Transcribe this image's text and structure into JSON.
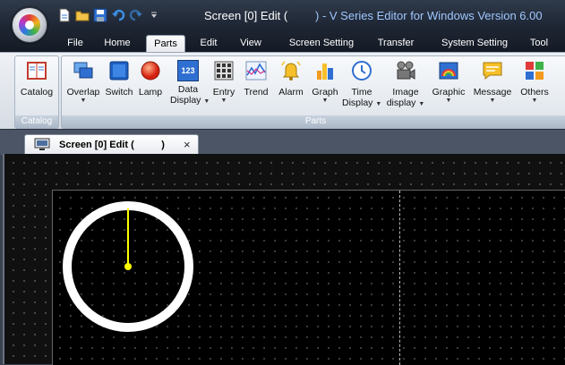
{
  "window": {
    "title_prefix": "Screen [0] Edit (",
    "title_suffix": ") - V Series Editor for Windows Version 6.00"
  },
  "menu_tabs": [
    {
      "label": "File"
    },
    {
      "label": "Home"
    },
    {
      "label": "Parts",
      "active": true
    },
    {
      "label": "Edit"
    },
    {
      "label": "View"
    },
    {
      "label": "Screen Setting"
    },
    {
      "label": "Transfer"
    },
    {
      "label": "System Setting"
    },
    {
      "label": "Tool"
    }
  ],
  "ribbon": {
    "catalog_group": {
      "label": "Catalog",
      "button": "Catalog"
    },
    "parts_group": {
      "label": "Parts",
      "buttons": [
        {
          "label": "Overlap",
          "arrow": "▼",
          "icon": "overlap-icon"
        },
        {
          "label": "Switch",
          "icon": "switch-icon"
        },
        {
          "label": "Lamp",
          "icon": "lamp-icon"
        },
        {
          "label": "Data",
          "label2": "Display",
          "arrow": "▼",
          "icon": "data-display-icon",
          "icon_text": "123"
        },
        {
          "label": "Entry",
          "arrow": "▼",
          "icon": "entry-icon"
        },
        {
          "label": "Trend",
          "icon": "trend-icon"
        },
        {
          "label": "Alarm",
          "icon": "alarm-icon"
        },
        {
          "label": "Graph",
          "arrow": "▼",
          "icon": "graph-icon"
        },
        {
          "label": "Time",
          "label2": "Display",
          "arrow": "▼",
          "icon": "time-display-icon"
        },
        {
          "label": "Image",
          "label2": "display",
          "arrow": "▼",
          "icon": "image-display-icon"
        },
        {
          "label": "Graphic",
          "arrow": "▼",
          "icon": "graphic-icon"
        },
        {
          "label": "Message",
          "arrow": "▼",
          "icon": "message-icon"
        },
        {
          "label": "Others",
          "arrow": "▼",
          "icon": "others-icon"
        }
      ]
    }
  },
  "document_tab": {
    "title": "Screen [0] Edit (          )",
    "close": "×"
  },
  "colors": {
    "title_accent": "#9fc7ff",
    "gauge_ring": "#ffffff",
    "gauge_needle": "#ffff00"
  }
}
